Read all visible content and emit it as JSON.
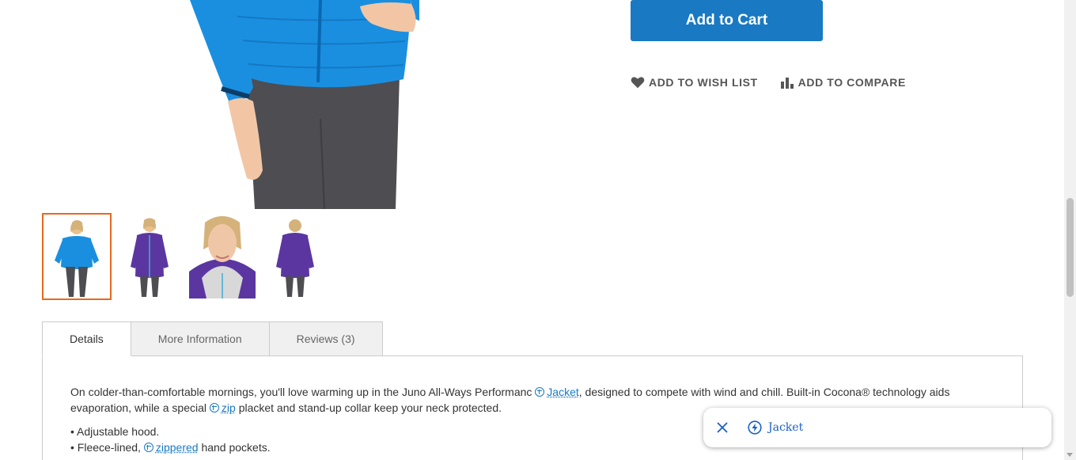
{
  "product": {
    "add_to_cart_label": "Add to Cart",
    "wishlist_label": "ADD TO WISH LIST",
    "compare_label": "ADD TO COMPARE",
    "colors": {
      "primary": "#1979c3",
      "thumb_active": "#e66a1f",
      "jacket_blue": "#1a8fe0",
      "jacket_purple": "#5b36a0"
    }
  },
  "tabs": [
    {
      "label": "Details"
    },
    {
      "label": "More Information"
    },
    {
      "label": "Reviews (3)"
    }
  ],
  "details": {
    "p1_a": "On colder-than-comfortable mornings, you'll love warming up in the Juno All-Ways Performanc",
    "kw_jacket": "Jacket",
    "p1_b": ", designed to compete with wind and chill. Built-in Cocona® technology aids evaporation, while a special",
    "kw_zip": "zip",
    "p1_c": "placket and stand-up collar keep your neck protected.",
    "features": {
      "f1": "• Adjustable hood.",
      "f2_a": "• Fleece-lined,",
      "f2_kw": "zippered",
      "f2_b": "hand pockets."
    }
  },
  "popup": {
    "keyword": "Jacket"
  }
}
